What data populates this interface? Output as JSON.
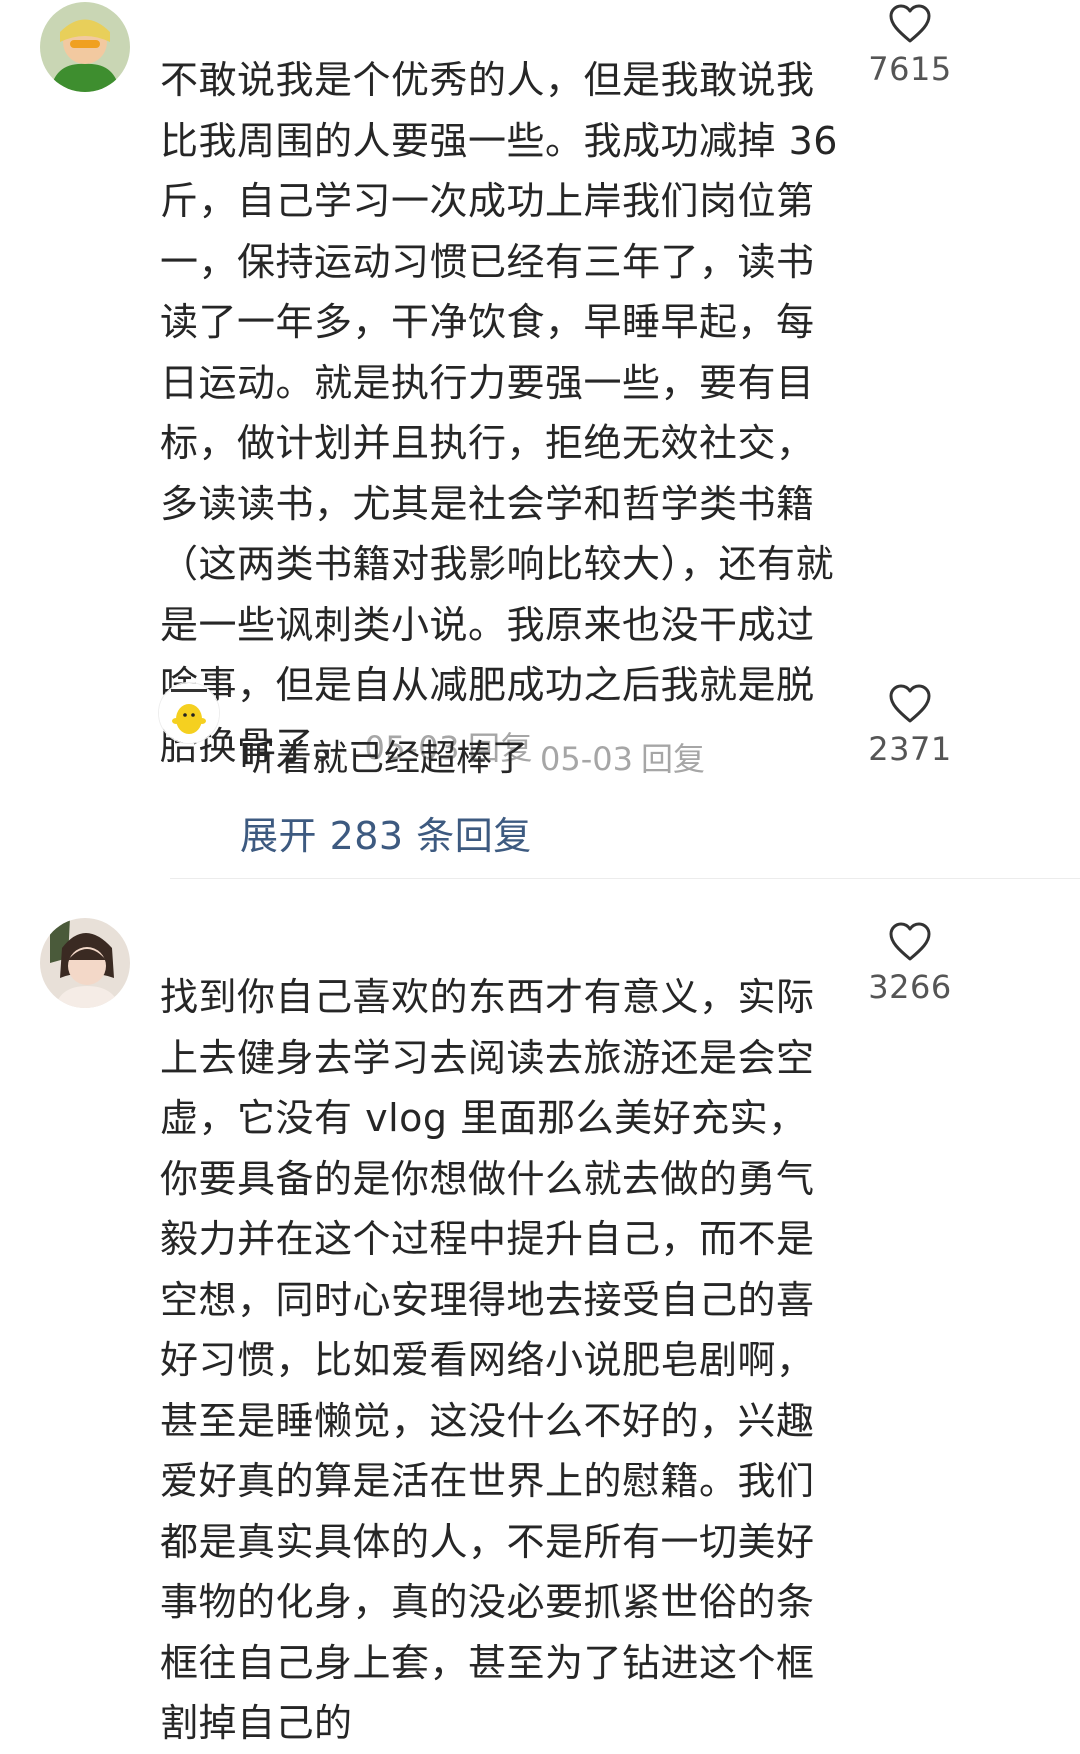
{
  "comments": [
    {
      "avatar": "green-outfit-girl-avatar",
      "text": "不敢说我是个优秀的人，但是我敢说我比我周围的人要强一些。我成功减掉 36 斤，自己学习一次成功上岸我们岗位第一，保持运动习惯已经有三年了，读书读了一年多，干净饮食，早睡早起，每日运动。就是执行力要强一些，要有目标，做计划并且执行，拒绝无效社交，多读读书，尤其是社会学和哲学类书籍（这两类书籍对我影响比较大），还有就是一些讽刺类小说。我原来也没干成过啥事，但是自从减肥成功之后我就是脱胎换骨了。",
      "date": "05-03",
      "reply_label": "回复",
      "like_count": "7615",
      "reply": {
        "avatar": "yellow-cartoon-avatar",
        "text": "听着就已经超棒了",
        "date": "05-03",
        "reply_label": "回复",
        "like_count": "2371"
      },
      "expand_label": "展开 283 条回复"
    },
    {
      "avatar": "smiling-girl-avatar",
      "text": "找到你自己喜欢的东西才有意义，实际上去健身去学习去阅读去旅游还是会空虚，它没有 vlog 里面那么美好充实，你要具备的是你想做什么就去做的勇气毅力并在这个过程中提升自己，而不是空想，同时心安理得地去接受自己的喜好习惯，比如爱看网络小说肥皂剧啊，甚至是睡懒觉，这没什么不好的，兴趣爱好真的算是活在世界上的慰籍。我们都是真实具体的人，不是所有一切美好事物的化身，真的没必要抓紧世俗的条框往自己身上套，甚至为了钻进这个框割掉自己的",
      "like_count": "3266"
    }
  ],
  "colors": {
    "text": "#262626",
    "meta": "#a6a6a6",
    "link": "#3d5a80",
    "divider": "#ececec"
  },
  "icons": {
    "like": "heart-outline-icon"
  }
}
